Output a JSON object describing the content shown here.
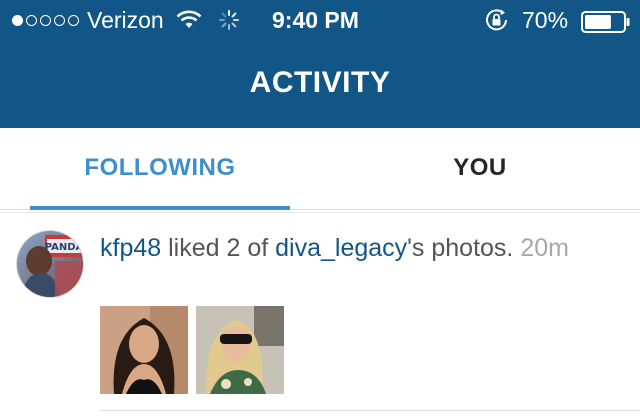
{
  "status_bar": {
    "signal_dots": 5,
    "signal_filled": 1,
    "carrier": "Verizon",
    "time": "9:40 PM",
    "battery_percent": "70%",
    "battery_level": 0.7
  },
  "header": {
    "title": "ACTIVITY"
  },
  "tabs": [
    {
      "label": "FOLLOWING",
      "active": true
    },
    {
      "label": "YOU",
      "active": false
    }
  ],
  "colors": {
    "brand": "#125688",
    "accent": "#3f8fce",
    "muted": "#a8a8a8",
    "text": "#555555"
  },
  "activity": {
    "actor": "kfp48",
    "action_mid": " liked 2 of ",
    "target": "diva_legacy",
    "action_end": "'s photos. ",
    "time_ago": "20m",
    "avatar_badge": "PANDA",
    "thumbnails": [
      {
        "name": "liked-photo-1"
      },
      {
        "name": "liked-photo-2"
      }
    ]
  }
}
